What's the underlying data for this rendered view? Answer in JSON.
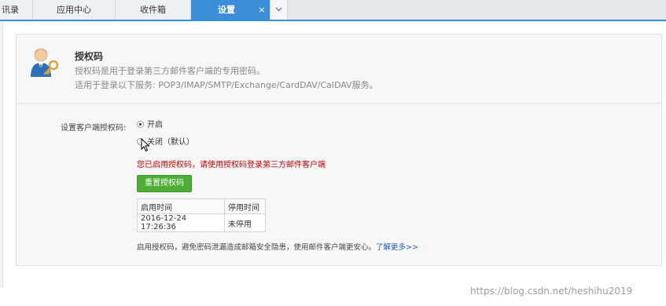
{
  "tabs": {
    "partial_first": "讯录",
    "app_center": "应用中心",
    "inbox": "收件箱",
    "settings": "设置",
    "close_glyph": "×",
    "more_glyph": "v"
  },
  "header": {
    "title": "授权码",
    "desc_line1": "授权码是用于登录第三方邮件客户端的专用密码。",
    "desc_line2": "适用于登录以下服务: POP3/IMAP/SMTP/Exchange/CardDAV/CalDAV服务。",
    "icon": "user-key-icon"
  },
  "setting": {
    "label": "设置客户端授权码:",
    "options": [
      {
        "label": "开启",
        "checked": true
      },
      {
        "label": "关闭（默认）",
        "checked": false
      }
    ]
  },
  "warning": "您已启用授权码，请使用授权码登录第三方邮件客户端",
  "reset_button": "重置授权码",
  "table": {
    "headers": [
      "启用时间",
      "停用时间"
    ],
    "rows": [
      [
        "2016-12-24 17:26:36",
        "未停用"
      ]
    ]
  },
  "footer_note": "启用授权码，避免密码泄漏造成邮箱安全隐患，使用邮件客户端更安心。",
  "learn_more": "了解更多>>",
  "watermark": "https://blog.csdn.net/heshihu2019",
  "colors": {
    "accent_tab": "#3c8ed8",
    "button_green": "#4cae34",
    "warning_red": "#c00000",
    "link_blue": "#1e5db4"
  }
}
